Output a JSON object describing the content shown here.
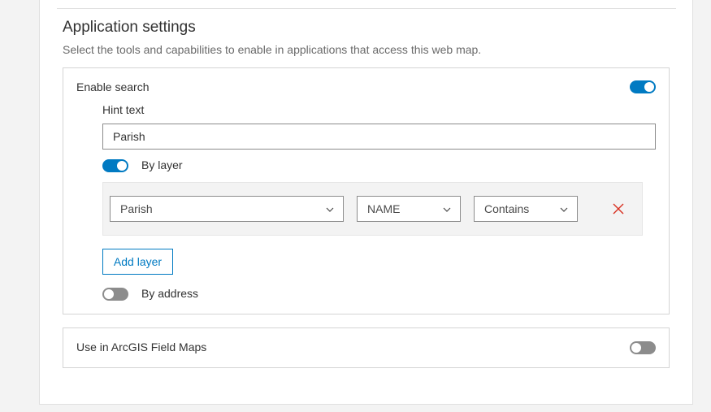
{
  "section": {
    "title": "Application settings",
    "description": "Select the tools and capabilities to enable in applications that access this web map."
  },
  "search": {
    "label": "Enable search",
    "enabled": true,
    "hint_label": "Hint text",
    "hint_value": "Parish",
    "by_layer": {
      "label": "By layer",
      "enabled": true
    },
    "layer_row": {
      "layer": "Parish",
      "field": "NAME",
      "operator": "Contains"
    },
    "add_layer_label": "Add layer",
    "by_address": {
      "label": "By address",
      "enabled": false
    }
  },
  "field_maps": {
    "label": "Use in ArcGIS Field Maps",
    "enabled": false
  },
  "colors": {
    "accent": "#007ac2",
    "toggle_off": "#8c8c8c",
    "remove": "#d83020"
  }
}
